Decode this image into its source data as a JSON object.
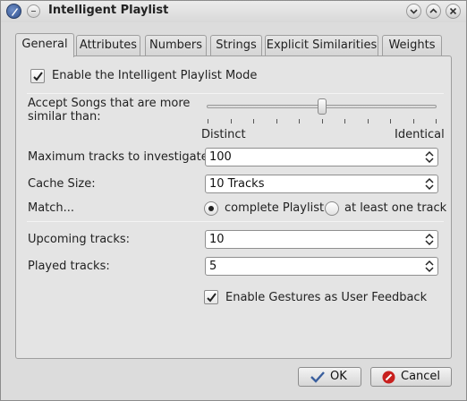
{
  "window": {
    "title": "Intelligent Playlist",
    "icons": {
      "app": "app-logo-icon",
      "menu": "window-menu-icon",
      "minimize": "minimize-icon",
      "maximize": "maximize-icon",
      "close": "close-icon"
    }
  },
  "tabs": [
    {
      "label": "General",
      "active": true
    },
    {
      "label": "Attributes"
    },
    {
      "label": "Numbers"
    },
    {
      "label": "Strings"
    },
    {
      "label": "Explicit Similarities"
    },
    {
      "label": "Weights"
    }
  ],
  "general": {
    "enable_mode": {
      "label": "Enable the Intelligent Playlist Mode",
      "checked": true
    },
    "similarity": {
      "label_line1": "Accept Songs that are more",
      "label_line2": "similar than:",
      "min_label": "Distinct",
      "max_label": "Identical",
      "value_fraction": 0.5,
      "tick_count": 11
    },
    "max_tracks": {
      "label": "Maximum tracks to investigate:",
      "value": "100"
    },
    "cache_size": {
      "label": "Cache Size:",
      "value": "10 Tracks"
    },
    "match": {
      "label": "Match...",
      "options": [
        {
          "label": "complete Playlist",
          "checked": true
        },
        {
          "label": "at least one track",
          "checked": false
        }
      ]
    },
    "upcoming": {
      "label": "Upcoming tracks:",
      "value": "10"
    },
    "played": {
      "label": "Played tracks:",
      "value": "5"
    },
    "gestures": {
      "label": "Enable Gestures as User Feedback",
      "checked": true
    }
  },
  "buttons": {
    "ok": "OK",
    "cancel": "Cancel",
    "ok_icon": "checkmark-icon",
    "cancel_icon": "cancel-icon",
    "ok_icon_color": "#3a5f9e",
    "cancel_icon_color": "#c8201e"
  }
}
